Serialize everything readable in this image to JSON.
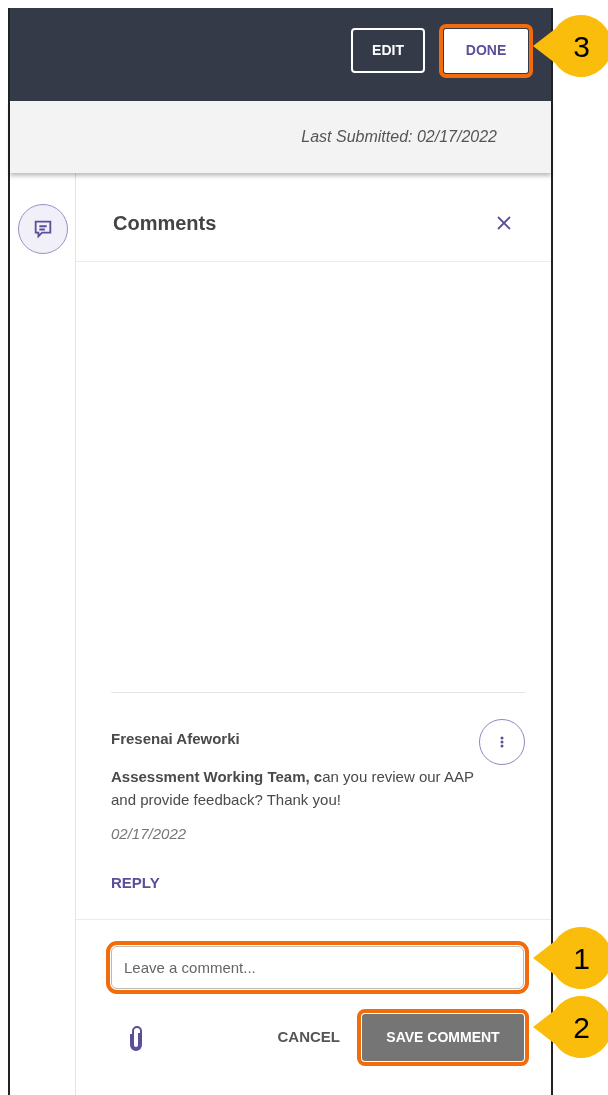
{
  "header": {
    "buttons": [
      {
        "label": "EDIT",
        "kind": "outline",
        "highlighted": false
      },
      {
        "label": "DONE",
        "kind": "filled",
        "highlighted": true
      }
    ]
  },
  "last_submitted": "Last Submitted: 02/17/2022",
  "comments_panel": {
    "title": "Comments"
  },
  "comments": [
    {
      "author": "Fresenai Afeworki",
      "text": "**Assessment Working Team, c**an you review our AAP and provide feedback? Thank you!",
      "date": "02/17/2022",
      "reply": "REPLY"
    }
  ],
  "composer": {
    "placeholder": "Leave a comment...",
    "highlighted": true,
    "cancel": "CANCEL",
    "save": {
      "label": "SAVE COMMENT",
      "highlighted": true
    }
  },
  "callouts": [
    {
      "number": "3",
      "kind": "header"
    },
    {
      "number": "1",
      "kind": "field"
    },
    {
      "number": "2",
      "kind": "button"
    }
  ]
}
